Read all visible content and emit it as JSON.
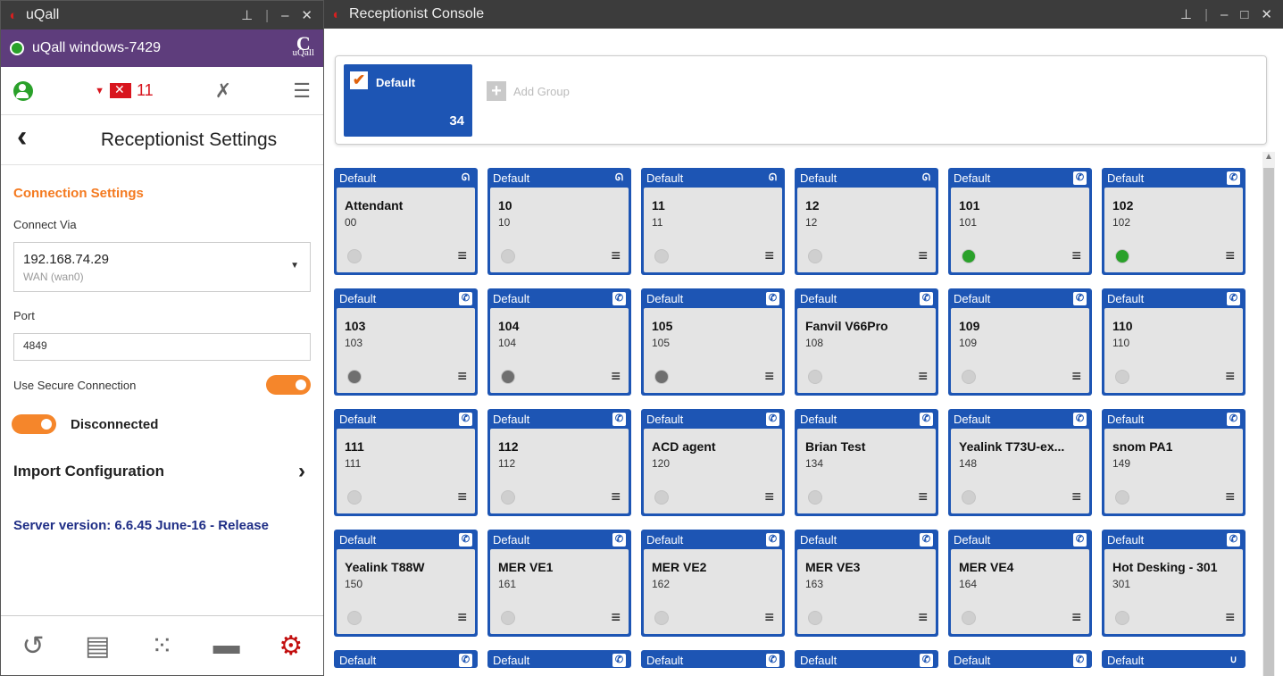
{
  "left_window": {
    "title": "uQall",
    "account_name": "uQall windows-7429",
    "logo_small": "uQall",
    "unread_count": "11",
    "settings_title": "Receptionist Settings",
    "connection_heading": "Connection Settings",
    "connect_via_label": "Connect Via",
    "connect_via_ip": "192.168.74.29",
    "connect_via_sub": "WAN (wan0)",
    "port_label": "Port",
    "port_value": "4849",
    "secure_label": "Use Secure Connection",
    "secure_on": true,
    "status_label": "Disconnected",
    "import_label": "Import Configuration",
    "server_version": "Server version: 6.6.45 June-16 - Release",
    "bottom_nav": [
      "history-icon",
      "contacts-icon",
      "dialpad-icon",
      "chat-icon",
      "settings-gear-icon"
    ]
  },
  "right_window": {
    "title": "Receptionist Console",
    "group_name": "Default",
    "group_count": "34",
    "add_group_label": "Add Group",
    "cards": [
      {
        "group": "Default",
        "name": "Attendant",
        "number": "00",
        "icon": "headset-icon",
        "presence": "none"
      },
      {
        "group": "Default",
        "name": "10",
        "number": "10",
        "icon": "headset-icon",
        "presence": "none"
      },
      {
        "group": "Default",
        "name": "11",
        "number": "11",
        "icon": "headset-icon",
        "presence": "none"
      },
      {
        "group": "Default",
        "name": "12",
        "number": "12",
        "icon": "headset-icon",
        "presence": "none"
      },
      {
        "group": "Default",
        "name": "101",
        "number": "101",
        "icon": "phone-icon",
        "presence": "online"
      },
      {
        "group": "Default",
        "name": "102",
        "number": "102",
        "icon": "phone-icon",
        "presence": "online"
      },
      {
        "group": "Default",
        "name": "103",
        "number": "103",
        "icon": "phone-icon",
        "presence": "busy"
      },
      {
        "group": "Default",
        "name": "104",
        "number": "104",
        "icon": "phone-icon",
        "presence": "busy"
      },
      {
        "group": "Default",
        "name": "105",
        "number": "105",
        "icon": "phone-icon",
        "presence": "busy"
      },
      {
        "group": "Default",
        "name": "Fanvil V66Pro",
        "number": "108",
        "icon": "phone-icon",
        "presence": "none"
      },
      {
        "group": "Default",
        "name": "109",
        "number": "109",
        "icon": "phone-icon",
        "presence": "none"
      },
      {
        "group": "Default",
        "name": "110",
        "number": "110",
        "icon": "phone-icon",
        "presence": "none"
      },
      {
        "group": "Default",
        "name": "111",
        "number": "111",
        "icon": "phone-icon",
        "presence": "none"
      },
      {
        "group": "Default",
        "name": "112",
        "number": "112",
        "icon": "phone-icon",
        "presence": "none"
      },
      {
        "group": "Default",
        "name": "ACD agent",
        "number": "120",
        "icon": "phone-icon",
        "presence": "none"
      },
      {
        "group": "Default",
        "name": "Brian Test",
        "number": "134",
        "icon": "phone-icon",
        "presence": "none"
      },
      {
        "group": "Default",
        "name": "Yealink T73U-ex...",
        "number": "148",
        "icon": "phone-icon",
        "presence": "none"
      },
      {
        "group": "Default",
        "name": "snom PA1",
        "number": "149",
        "icon": "phone-icon",
        "presence": "none"
      },
      {
        "group": "Default",
        "name": "Yealink T88W",
        "number": "150",
        "icon": "phone-icon",
        "presence": "none"
      },
      {
        "group": "Default",
        "name": "MER VE1",
        "number": "161",
        "icon": "phone-icon",
        "presence": "none"
      },
      {
        "group": "Default",
        "name": "MER VE2",
        "number": "162",
        "icon": "phone-icon",
        "presence": "none"
      },
      {
        "group": "Default",
        "name": "MER VE3",
        "number": "163",
        "icon": "phone-icon",
        "presence": "none"
      },
      {
        "group": "Default",
        "name": "MER VE4",
        "number": "164",
        "icon": "phone-icon",
        "presence": "none"
      },
      {
        "group": "Default",
        "name": "Hot Desking - 301",
        "number": "301",
        "icon": "phone-icon",
        "presence": "none"
      },
      {
        "group": "Default",
        "name": "",
        "number": "",
        "icon": "phone-icon",
        "presence": "none"
      },
      {
        "group": "Default",
        "name": "",
        "number": "",
        "icon": "phone-icon",
        "presence": "none"
      },
      {
        "group": "Default",
        "name": "",
        "number": "",
        "icon": "phone-icon",
        "presence": "none"
      },
      {
        "group": "Default",
        "name": "",
        "number": "",
        "icon": "phone-icon",
        "presence": "none"
      },
      {
        "group": "Default",
        "name": "",
        "number": "",
        "icon": "phone-icon",
        "presence": "none"
      },
      {
        "group": "Default",
        "name": "",
        "number": "",
        "icon": "voicemail-icon",
        "presence": "none"
      }
    ]
  },
  "colors": {
    "accent": "#1d55b4",
    "purple": "#5e3d7c",
    "orange": "#f5862b",
    "brand_red": "#d62020",
    "server_text": "#1f2e86"
  }
}
